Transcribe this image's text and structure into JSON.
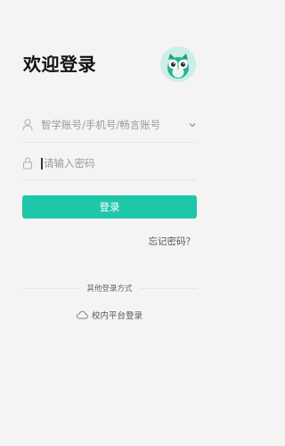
{
  "header": {
    "title": "欢迎登录",
    "logo_icon": "owl-logo-icon"
  },
  "form": {
    "account": {
      "placeholder": "智学账号/手机号/畅言账号",
      "icon": "user-icon",
      "dropdown_icon": "chevron-down-icon"
    },
    "password": {
      "placeholder": "请输入密码",
      "icon": "lock-icon"
    },
    "login_label": "登录",
    "forgot_label": "忘记密码？"
  },
  "other": {
    "title": "其他登录方式",
    "campus_label": "校内平台登录",
    "campus_icon": "cloud-icon"
  },
  "colors": {
    "accent": "#1ec7a8",
    "background": "#f4f4f4"
  }
}
